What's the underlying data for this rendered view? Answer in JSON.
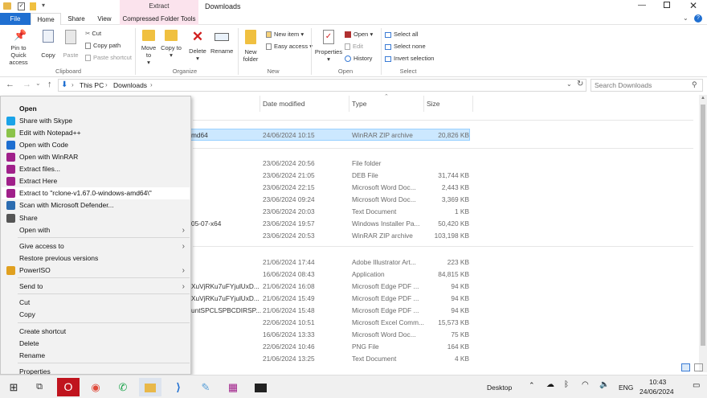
{
  "window": {
    "title": "Downloads",
    "extract_tab": "Extract"
  },
  "tabs": {
    "file": "File",
    "home": "Home",
    "share": "Share",
    "view": "View",
    "cft": "Compressed Folder Tools"
  },
  "ribbon": {
    "pin": "Pin to Quick access",
    "copy": "Copy",
    "paste": "Paste",
    "cut": "Cut",
    "copy_path": "Copy path",
    "paste_shortcut": "Paste shortcut",
    "clipboard": "Clipboard",
    "move_to": "Move to",
    "copy_to": "Copy to",
    "delete": "Delete",
    "rename": "Rename",
    "organize": "Organize",
    "new_folder": "New folder",
    "new_item": "New item",
    "easy_access": "Easy access",
    "new": "New",
    "properties": "Properties",
    "open": "Open",
    "edit": "Edit",
    "history": "History",
    "open_group": "Open",
    "select_all": "Select all",
    "select_none": "Select none",
    "invert": "Invert selection",
    "select": "Select"
  },
  "address": {
    "this_pc": "This PC",
    "downloads": "Downloads",
    "search_placeholder": "Search Downloads"
  },
  "columns": {
    "date": "Date modified",
    "type": "Type",
    "size": "Size"
  },
  "rows": [
    {
      "name": "md64",
      "date": "24/06/2024 10:15",
      "type": "WinRAR ZIP archive",
      "size": "20,826 KB"
    },
    {
      "name": "",
      "date": "23/06/2024 20:56",
      "type": "File folder",
      "size": ""
    },
    {
      "name": "",
      "date": "23/06/2024 21:05",
      "type": "DEB File",
      "size": "31,744 KB"
    },
    {
      "name": "",
      "date": "23/06/2024 22:15",
      "type": "Microsoft Word Doc...",
      "size": "2,443 KB"
    },
    {
      "name": "",
      "date": "23/06/2024 09:24",
      "type": "Microsoft Word Doc...",
      "size": "3,369 KB"
    },
    {
      "name": "",
      "date": "23/06/2024 20:03",
      "type": "Text Document",
      "size": "1 KB"
    },
    {
      "name": "05-07-x64",
      "date": "23/06/2024 19:57",
      "type": "Windows Installer Pa...",
      "size": "50,420 KB"
    },
    {
      "name": "",
      "date": "23/06/2024 20:53",
      "type": "WinRAR ZIP archive",
      "size": "103,198 KB"
    },
    {
      "name": "",
      "date": "21/06/2024 17:44",
      "type": "Adobe Illustrator Art...",
      "size": "223 KB"
    },
    {
      "name": "",
      "date": "16/06/2024 08:43",
      "type": "Application",
      "size": "84,815 KB"
    },
    {
      "name": "XuVjRKu7uFYjulUxD...",
      "date": "21/06/2024 16:08",
      "type": "Microsoft Edge PDF ...",
      "size": "94 KB"
    },
    {
      "name": "XuVjRKu7uFYjulUxD...",
      "date": "21/06/2024 15:49",
      "type": "Microsoft Edge PDF ...",
      "size": "94 KB"
    },
    {
      "name": "untSPCLSPBCDIRSP...",
      "date": "21/06/2024 15:48",
      "type": "Microsoft Edge PDF ...",
      "size": "94 KB"
    },
    {
      "name": "",
      "date": "22/06/2024 10:51",
      "type": "Microsoft Excel Comm...",
      "size": "15,573 KB"
    },
    {
      "name": "",
      "date": "16/06/2024 13:33",
      "type": "Microsoft Word Doc...",
      "size": "75 KB"
    },
    {
      "name": "",
      "date": "22/06/2024 10:46",
      "type": "PNG File",
      "size": "164 KB"
    },
    {
      "name": "",
      "date": "21/06/2024 13:25",
      "type": "Text Document",
      "size": "4 KB"
    }
  ],
  "menu": {
    "open": "Open",
    "skype": "Share with Skype",
    "notepad": "Edit with Notepad++",
    "code": "Open with Code",
    "winrar": "Open with WinRAR",
    "extract_files": "Extract files...",
    "extract_here": "Extract Here",
    "extract_to": "Extract to \"rclone-v1.67.0-windows-amd64\\\"",
    "defender": "Scan with Microsoft Defender...",
    "share": "Share",
    "open_with": "Open with",
    "give_access": "Give access to",
    "restore": "Restore previous versions",
    "poweriso": "PowerISO",
    "send_to": "Send to",
    "cut": "Cut",
    "copy": "Copy",
    "create_shortcut": "Create shortcut",
    "delete": "Delete",
    "rename": "Rename",
    "properties": "Properties"
  },
  "taskbar": {
    "desktop": "Desktop",
    "lang": "ENG",
    "time": "10:43",
    "date": "24/06/2024"
  },
  "colors": {
    "accent": "#1f6fd1",
    "selected": "#cce8ff",
    "extract_tab": "#fbe3ed"
  }
}
